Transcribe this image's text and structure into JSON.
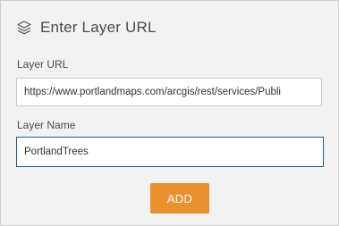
{
  "dialog": {
    "title": "Enter Layer URL",
    "icon": "layers-icon"
  },
  "form": {
    "url_label": "Layer URL",
    "url_value": "https://www.portlandmaps.com/arcgis/rest/services/Publi",
    "name_label": "Layer Name",
    "name_value": "PortlandTrees",
    "add_label": "ADD"
  },
  "colors": {
    "accent": "#e8912e",
    "panel_bg": "#f2f2f2",
    "focus_border": "#2b5a7d"
  }
}
